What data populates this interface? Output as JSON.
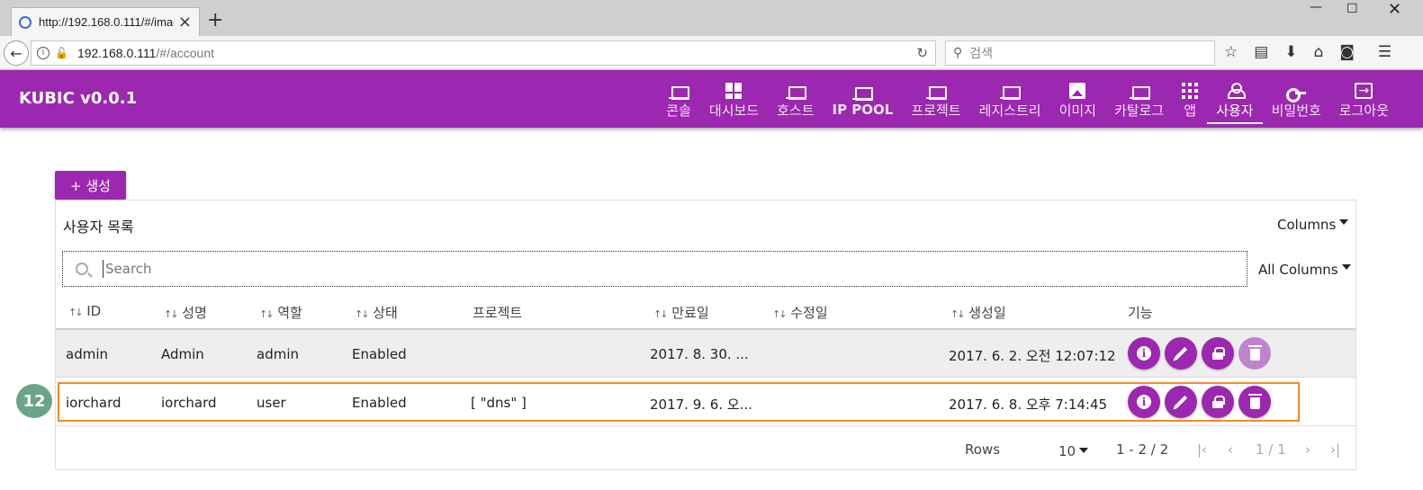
{
  "browser": {
    "tab_title": "http://192.168.0.111/#/imag",
    "url_host": "192.168.0.111",
    "url_path": "/#/account",
    "search_placeholder": "검색"
  },
  "app": {
    "brand": "KUBIC v0.0.1",
    "accent_color": "#9c27b0",
    "nav": [
      {
        "label": "콘솔",
        "icon": "laptop-icon"
      },
      {
        "label": "대시보드",
        "icon": "dashboard-icon"
      },
      {
        "label": "호스트",
        "icon": "laptop-icon"
      },
      {
        "label": "IP POOL",
        "icon": "laptop-icon"
      },
      {
        "label": "프로젝트",
        "icon": "laptop-icon"
      },
      {
        "label": "레지스트리",
        "icon": "laptop-icon"
      },
      {
        "label": "이미지",
        "icon": "image-icon"
      },
      {
        "label": "카탈로그",
        "icon": "laptop-icon"
      },
      {
        "label": "앱",
        "icon": "apps-icon"
      },
      {
        "label": "사용자",
        "icon": "person-icon",
        "active": true
      },
      {
        "label": "비밀번호",
        "icon": "key-icon"
      },
      {
        "label": "로그아웃",
        "icon": "logout-icon"
      }
    ]
  },
  "content": {
    "create_label": "+ 생성",
    "panel_title": "사용자 목록",
    "columns_label": "Columns",
    "search_placeholder": "Search",
    "search_scope": "All Columns",
    "headers": {
      "id": "ID",
      "name": "성명",
      "role": "역할",
      "status": "상태",
      "project": "프로젝트",
      "expiry": "만료일",
      "modified": "수정일",
      "created": "생성일",
      "actions": "기능"
    },
    "rows": [
      {
        "id": "admin",
        "name": "Admin",
        "role": "admin",
        "status": "Enabled",
        "project": "",
        "expiry": "2017. 8. 30. ...",
        "modified": "",
        "created": "2017. 6. 2. 오전 12:07:12"
      },
      {
        "id": "iorchard",
        "name": "iorchard",
        "role": "user",
        "status": "Enabled",
        "project": "[ \"dns\" ]",
        "expiry": "2017. 9. 6. 오...",
        "modified": "",
        "created": "2017. 6. 8. 오후 7:14:45"
      }
    ],
    "pager": {
      "rows_label": "Rows",
      "rows_per_page": "10",
      "range": "1 - 2 / 2",
      "page": "1 / 1"
    }
  },
  "annotation": {
    "step_number": "12",
    "highlight_color": "#f28a2e"
  }
}
